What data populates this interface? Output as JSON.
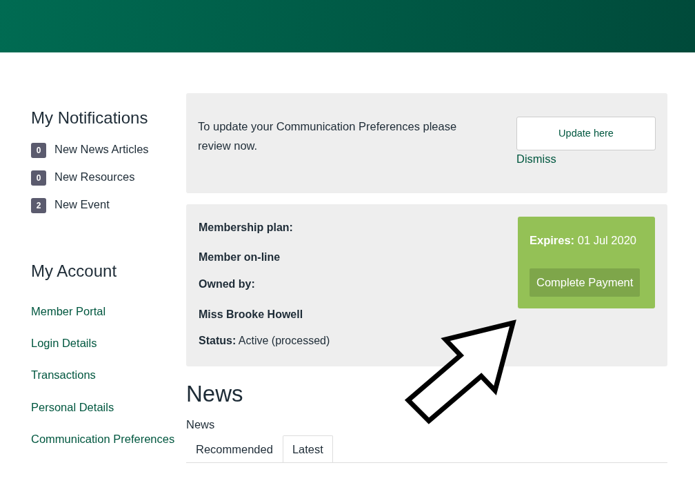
{
  "notifications": {
    "title": "My Notifications",
    "items": [
      {
        "count": "0",
        "label": "New News Articles"
      },
      {
        "count": "0",
        "label": "New Resources"
      },
      {
        "count": "2",
        "label": "New Event"
      }
    ]
  },
  "account": {
    "title": "My Account",
    "links": [
      "Member Portal",
      "Login Details",
      "Transactions",
      "Personal Details",
      "Communication Preferences"
    ]
  },
  "preferences_notice": {
    "text": "To update your Communication Preferences please review now.",
    "button": "Update here",
    "dismiss": "Dismiss"
  },
  "membership": {
    "lines": [
      {
        "label": "Membership plan:"
      },
      {
        "label": "Member on-line"
      },
      {
        "label": "Owned by:"
      },
      {
        "label": "Miss Brooke Howell"
      },
      {
        "label": "Status:",
        "value": "Active (processed)"
      }
    ],
    "expires_label": "Expires:",
    "expires_value": "01 Jul 2020",
    "payment_button": "Complete Payment"
  },
  "news": {
    "heading": "News",
    "subheading": "News",
    "tabs": [
      {
        "label": "Recommended",
        "selected": false
      },
      {
        "label": "Latest",
        "selected": true
      }
    ]
  }
}
